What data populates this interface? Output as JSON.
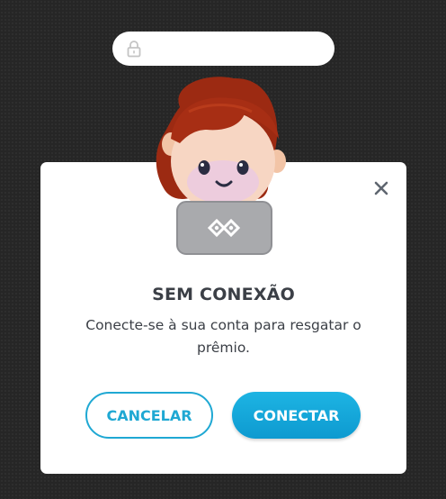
{
  "browser": {
    "address_value": "",
    "lock_icon": "lock-icon"
  },
  "dialog": {
    "title": "SEM CONEXÃO",
    "message": "Conecte-se à sua conta para resgatar o prêmio.",
    "close_icon": "close-icon",
    "avatar": "character-with-laptop-avatar",
    "cancel_label": "CANCELAR",
    "connect_label": "CONECTAR"
  },
  "colors": {
    "backdrop": "#262626",
    "accent": "#1fa8d3",
    "primary_button": "#0e9ad0",
    "text": "#3b3f46",
    "hair": "#9c2a12"
  }
}
